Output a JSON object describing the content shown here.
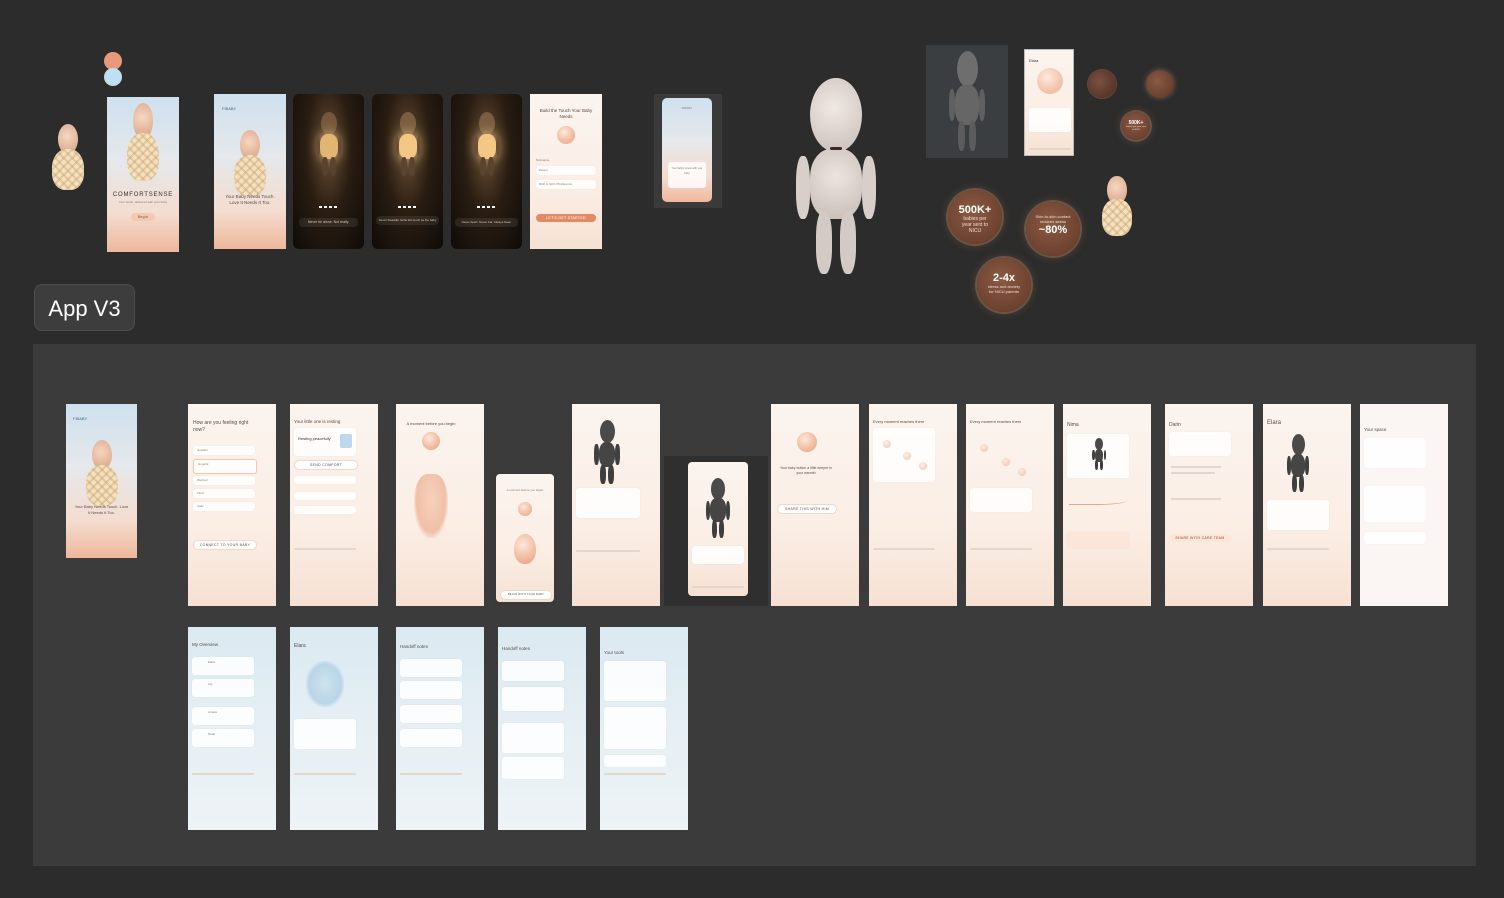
{
  "section": {
    "label": "App V3"
  },
  "colors": {
    "canvas": "#2c2c2c",
    "board": "#3b3b3b",
    "accent": "#e28a66",
    "swatch_peach": "#e79a7b",
    "swatch_blue": "#bfe0f2"
  },
  "onboarding": {
    "brand": "COMFORTSENSE",
    "brand_sub": "Your touch, delivered with your baby",
    "begin": "Begin",
    "tagline": "Your Baby Needs Touch. Love It Needs It Too.",
    "logo": "FIBABY",
    "dark_captions": [
      "Never be alone. Not really.",
      "Smart Swaddle holds felt touch as the baby",
      "Never Apart. Never Far. Always Near."
    ],
    "build_title": "Build the Touch Your Baby Needs",
    "form_labels": [
      "Nickname",
      "Parent",
      "Birth in NICU Preference"
    ],
    "cta": "LET'S GET STARTED",
    "mini_phone_text": "Your baby's stress with your baby"
  },
  "stats": [
    {
      "value": "500K+",
      "label": "babies per year sent to NICU"
    },
    {
      "value": "~80%",
      "label": "Skin-to-skin contact reduces stress"
    },
    {
      "value": "2-4x",
      "label": "stress and anxiety for NICU parents"
    },
    {
      "value": "500K+",
      "label": "babies per year sent to NICU"
    }
  ],
  "v3_screens": {
    "welcome_tagline": "Your Baby Needs Touch. Love It Needs It Too.",
    "feeling_title": "How are you feeling right now?",
    "feeling_options": [
      "Grateful",
      "Hopeful",
      "Worried",
      "Tired",
      "Calm"
    ],
    "feeling_cta": "CONNECT TO YOUR BABY",
    "resting_title": "Your little one is resting",
    "resting_status": "Resting peacefully",
    "send_comfort": "SEND COMFORT",
    "moment_title": "A moment before you begin",
    "moment_cta": "BEGIN WITH YOUR BABY",
    "pairing_title": "A moment before you begin",
    "baby_button_title": "Your baby button a little deeper in your warmth",
    "share_cta": "SHARE THIS WITH HIM",
    "every_moment_1": "Every moment reaches them",
    "every_moment_2": "Every moment reaches them",
    "name_1": "Nima",
    "name_2": "Darin",
    "name_3": "Elara",
    "your_space": "Your space",
    "share_care": "SHARE WITH CARE TEAM"
  },
  "v3_row2": {
    "overview_title": "My Overview",
    "patients": [
      "Elara",
      "Lily",
      "Amara",
      "Noah"
    ],
    "detail_name": "Elara",
    "handoff_title": "Handoff notes",
    "handoff_title_2": "Handoff notes",
    "your_tools": "Your tools"
  }
}
